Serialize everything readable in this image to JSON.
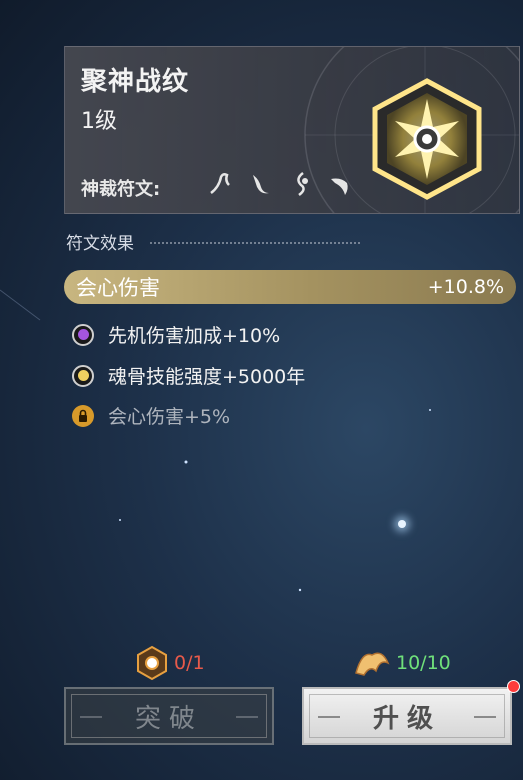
{
  "card": {
    "title": "聚神战纹",
    "level": "1级",
    "rune_label": "神裁符文:",
    "rune_icons": [
      "rune-icon-1",
      "rune-icon-2",
      "rune-icon-3",
      "rune-icon-4"
    ],
    "emblem_icon": "star-emblem-icon"
  },
  "section_title": "符文效果",
  "main_effect": {
    "name": "会心伤害",
    "value": "+10.8%"
  },
  "effects": [
    {
      "text": "先机伤害加成+10%",
      "icon": "purple-gem-icon",
      "locked": false
    },
    {
      "text": "魂骨技能强度+5000年",
      "icon": "yellow-gem-icon",
      "locked": false
    },
    {
      "text": "会心伤害+5%",
      "icon": "lock-icon",
      "locked": true
    }
  ],
  "costs": {
    "breakthrough": {
      "count": "0/1",
      "color": "#e85a4a"
    },
    "upgrade": {
      "count": "10/10",
      "color": "#6fe07a"
    }
  },
  "buttons": {
    "breakthrough": "突破",
    "upgrade": "升级"
  },
  "colors": {
    "gold_bar": "#b4a36c",
    "notification": "#ff3b3b"
  }
}
